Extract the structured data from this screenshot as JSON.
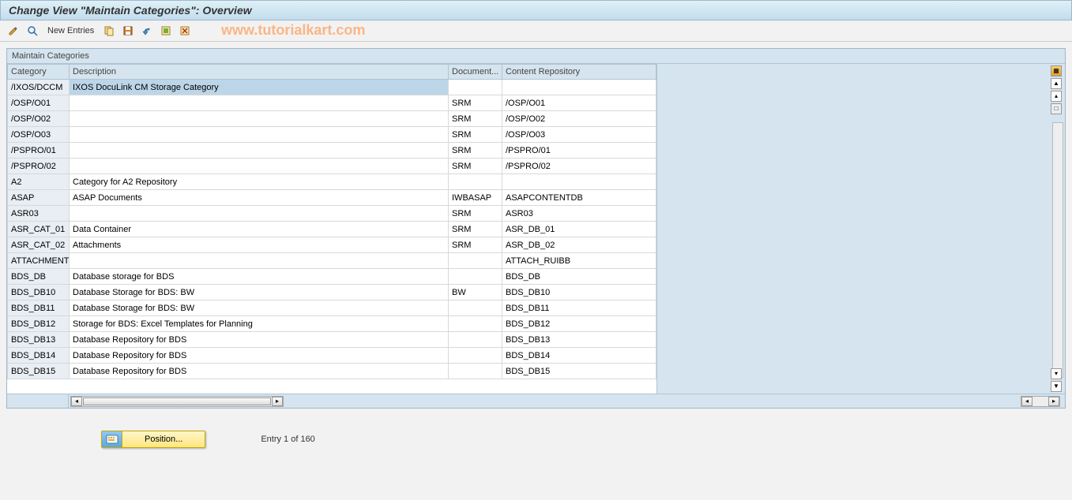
{
  "title": "Change View \"Maintain Categories\": Overview",
  "toolbar": {
    "new_entries": "New Entries"
  },
  "watermark": "www.tutorialkart.com",
  "panel": {
    "title": "Maintain Categories",
    "columns": {
      "category": "Category",
      "description": "Description",
      "document": "Document...",
      "repository": "Content Repository"
    },
    "rows": [
      {
        "category": "/IXOS/DCCM",
        "description": "IXOS DocuLink CM Storage Category",
        "document": "",
        "repository": "",
        "selected": true
      },
      {
        "category": "/OSP/O01",
        "description": "",
        "document": "SRM",
        "repository": "/OSP/O01"
      },
      {
        "category": "/OSP/O02",
        "description": "",
        "document": "SRM",
        "repository": "/OSP/O02"
      },
      {
        "category": "/OSP/O03",
        "description": "",
        "document": "SRM",
        "repository": "/OSP/O03"
      },
      {
        "category": "/PSPRO/01",
        "description": "",
        "document": "SRM",
        "repository": "/PSPRO/01"
      },
      {
        "category": "/PSPRO/02",
        "description": "",
        "document": "SRM",
        "repository": "/PSPRO/02"
      },
      {
        "category": "A2",
        "description": "Category for A2 Repository",
        "document": "",
        "repository": ""
      },
      {
        "category": "ASAP",
        "description": "ASAP Documents",
        "document": "IWBASAP",
        "repository": "ASAPCONTENTDB"
      },
      {
        "category": "ASR03",
        "description": "",
        "document": "SRM",
        "repository": "ASR03"
      },
      {
        "category": "ASR_CAT_01",
        "description": "Data Container",
        "document": "SRM",
        "repository": "ASR_DB_01"
      },
      {
        "category": "ASR_CAT_02",
        "description": "Attachments",
        "document": "SRM",
        "repository": "ASR_DB_02"
      },
      {
        "category": "ATTACHMENT",
        "description": "",
        "document": "",
        "repository": "ATTACH_RUIBB"
      },
      {
        "category": "BDS_DB",
        "description": "Database storage for BDS",
        "document": "",
        "repository": "BDS_DB"
      },
      {
        "category": "BDS_DB10",
        "description": "Database Storage for BDS: BW",
        "document": "BW",
        "repository": "BDS_DB10"
      },
      {
        "category": "BDS_DB11",
        "description": "Database Storage for BDS: BW",
        "document": "",
        "repository": "BDS_DB11"
      },
      {
        "category": "BDS_DB12",
        "description": "Storage for BDS: Excel Templates for Planning",
        "document": "",
        "repository": "BDS_DB12"
      },
      {
        "category": "BDS_DB13",
        "description": "Database Repository for BDS",
        "document": "",
        "repository": "BDS_DB13"
      },
      {
        "category": "BDS_DB14",
        "description": "Database Repository for BDS",
        "document": "",
        "repository": "BDS_DB14"
      },
      {
        "category": "BDS_DB15",
        "description": "Database Repository for BDS",
        "document": "",
        "repository": "BDS_DB15"
      }
    ]
  },
  "footer": {
    "position_label": "Position...",
    "entry_text": "Entry 1 of 160"
  }
}
